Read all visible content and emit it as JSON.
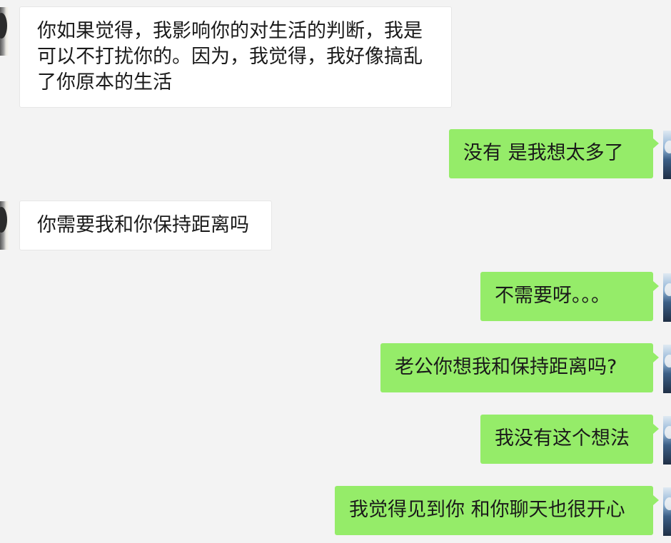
{
  "conversation": {
    "messages": [
      {
        "side": "incoming",
        "text": "你如果觉得，我影响你的对生活的判断，我是可以不打扰你的。因为，我觉得，我好像搞乱了你原本的生活"
      },
      {
        "side": "outgoing",
        "text": "没有 是我想太多了"
      },
      {
        "side": "incoming",
        "text": "你需要我和你保持距离吗"
      },
      {
        "side": "outgoing",
        "text": "不需要呀。。。"
      },
      {
        "side": "outgoing",
        "text": "老公你想我和保持距离吗?"
      },
      {
        "side": "outgoing",
        "text": "我没有这个想法"
      },
      {
        "side": "outgoing",
        "text": "我觉得见到你 和你聊天也很开心"
      }
    ]
  },
  "colors": {
    "background": "#f3f3f3",
    "incoming_bubble": "#ffffff",
    "outgoing_bubble": "#95ec69",
    "text": "#1a1a1a"
  },
  "icons": {
    "contact_avatar": "contact-avatar-icon",
    "self_avatar": "self-avatar-icon"
  }
}
